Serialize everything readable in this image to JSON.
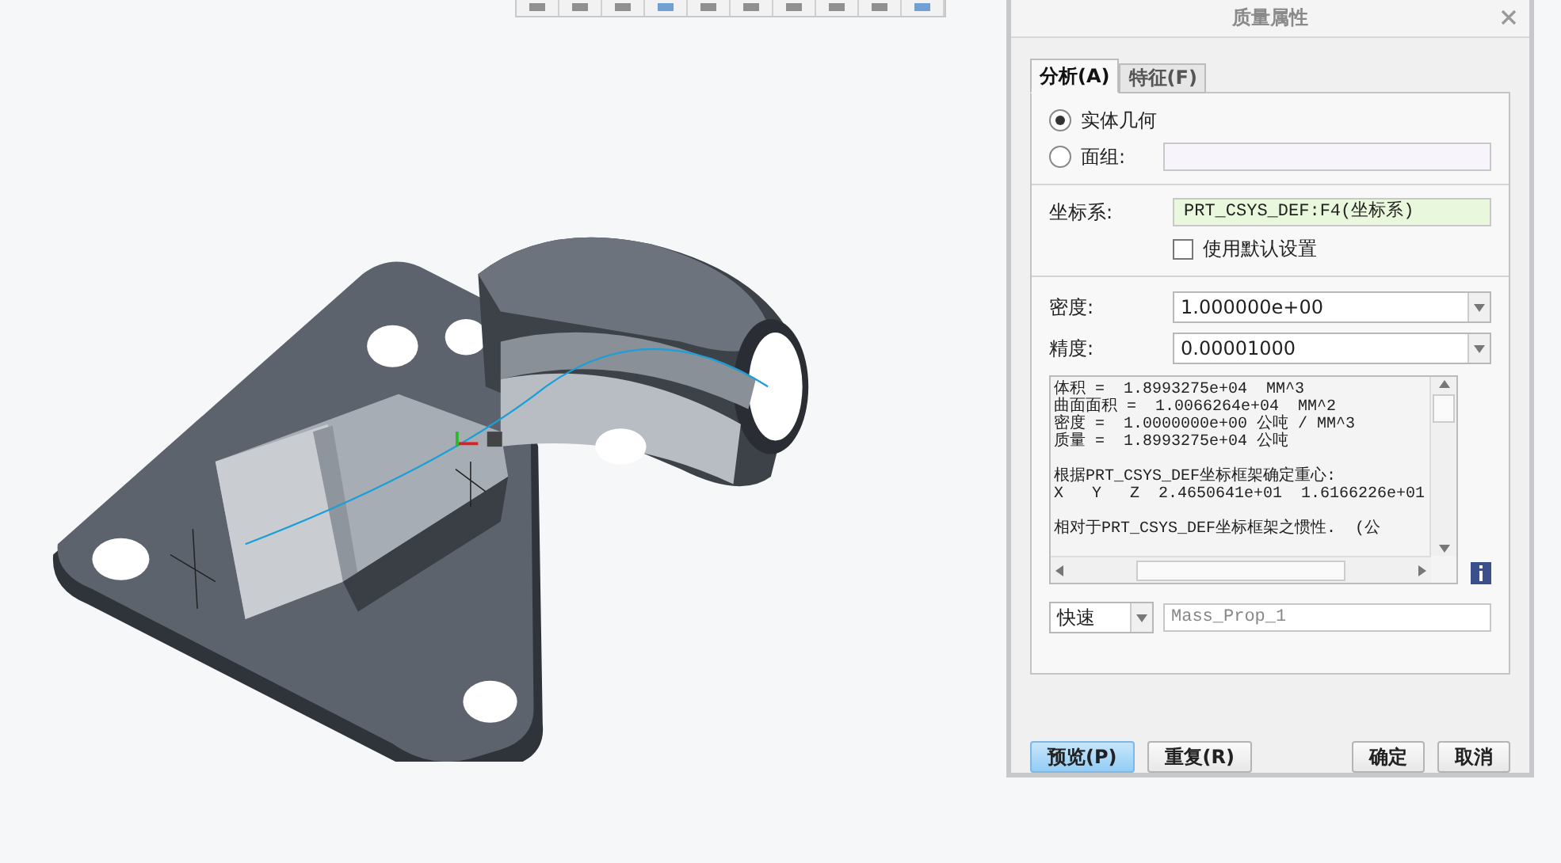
{
  "window": {
    "title": "质量属性"
  },
  "tabs": [
    {
      "label": "分析(A)",
      "selected": true
    },
    {
      "label": "特征(F)",
      "selected": false
    }
  ],
  "geometry_options": [
    {
      "label": "实体几何",
      "selected": true
    },
    {
      "label": "面组:",
      "selected": false
    }
  ],
  "coordinate_system": {
    "label": "坐标系:",
    "value": "PRT_CSYS_DEF:F4(坐标系)"
  },
  "use_default": {
    "label": "使用默认设置",
    "checked": false
  },
  "density": {
    "label": "密度:",
    "value": "1.000000e+00"
  },
  "accuracy": {
    "label": "精度:",
    "value": "0.00001000"
  },
  "results": [
    [
      "体积 =  1.8993275e+04  MM^3",
      "曲面面积 =  1.0066264e+04  MM^2",
      "密度 =  1.0000000e+00 公吨 / MM^3",
      "质量 =  1.8993275e+04 公吨"
    ],
    [
      "根据PRT_CSYS_DEF坐标框架确定重心:",
      "X   Y   Z  2.4650641e+01  1.6166226e+01"
    ],
    [
      "相对于PRT_CSYS_DEF坐标框架之惯性.  (公"
    ]
  ],
  "mode": {
    "value": "快速"
  },
  "name_field": {
    "placeholder": "Mass_Prop_1"
  },
  "buttons": [
    {
      "label": "预览(P)",
      "kind": "primary"
    },
    {
      "label": "重复(R)",
      "kind": "normal"
    },
    {
      "label": "确定",
      "kind": "normal"
    },
    {
      "label": "取消",
      "kind": "normal"
    }
  ]
}
